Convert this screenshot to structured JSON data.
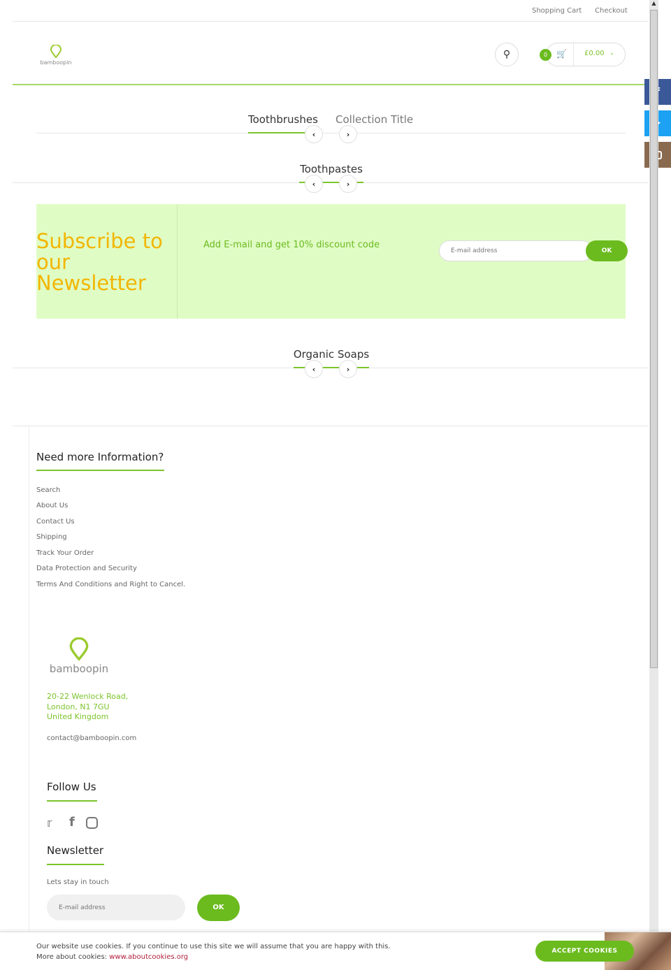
{
  "top_links": [
    "Shopping Cart",
    "Checkout"
  ],
  "header": {
    "logo_text": "bamboopin",
    "cart_count": "0",
    "cart_total": "£0.00"
  },
  "tabs": [
    "Toothbrushes",
    "Collection Title"
  ],
  "sections": [
    "Toothpastes",
    "Organic Soaps"
  ],
  "newsletter_banner": {
    "title": "Subscribe to our Newsletter",
    "subtitle": "Add E-mail and get 10% discount code",
    "placeholder": "E-mail address",
    "button": "OK"
  },
  "footer": {
    "info_title": "Need more Information?",
    "links": [
      "Search",
      "About Us",
      "Contact Us",
      "Shipping",
      "Track Your Order",
      "Data Protection and Security",
      "Terms And Conditions and Right to Cancel."
    ],
    "logo_text": "bamboopin",
    "address": [
      "20-22 Wenlock Road,",
      "London, N1 7GU",
      "United Kingdom"
    ],
    "email": "contact@bamboopin.com",
    "follow_title": "Follow Us",
    "newsletter_title": "Newsletter",
    "newsletter_text": "Lets stay in touch",
    "newsletter_placeholder": "E-mail address",
    "newsletter_button": "OK"
  },
  "cookie": {
    "text": "Our website use cookies. If you continue to use this site we will assume that you are happy with this.",
    "more_label": "More about cookies:",
    "link": "www.aboutcookies.org",
    "button": "ACCEPT COOKIES"
  },
  "colors": {
    "accent": "#7cc42b",
    "banner_bg": "#e0fcc5",
    "banner_title": "#f2b600",
    "facebook": "#3b5998",
    "twitter": "#1da1f2",
    "instagram": "#8a6a4f"
  }
}
